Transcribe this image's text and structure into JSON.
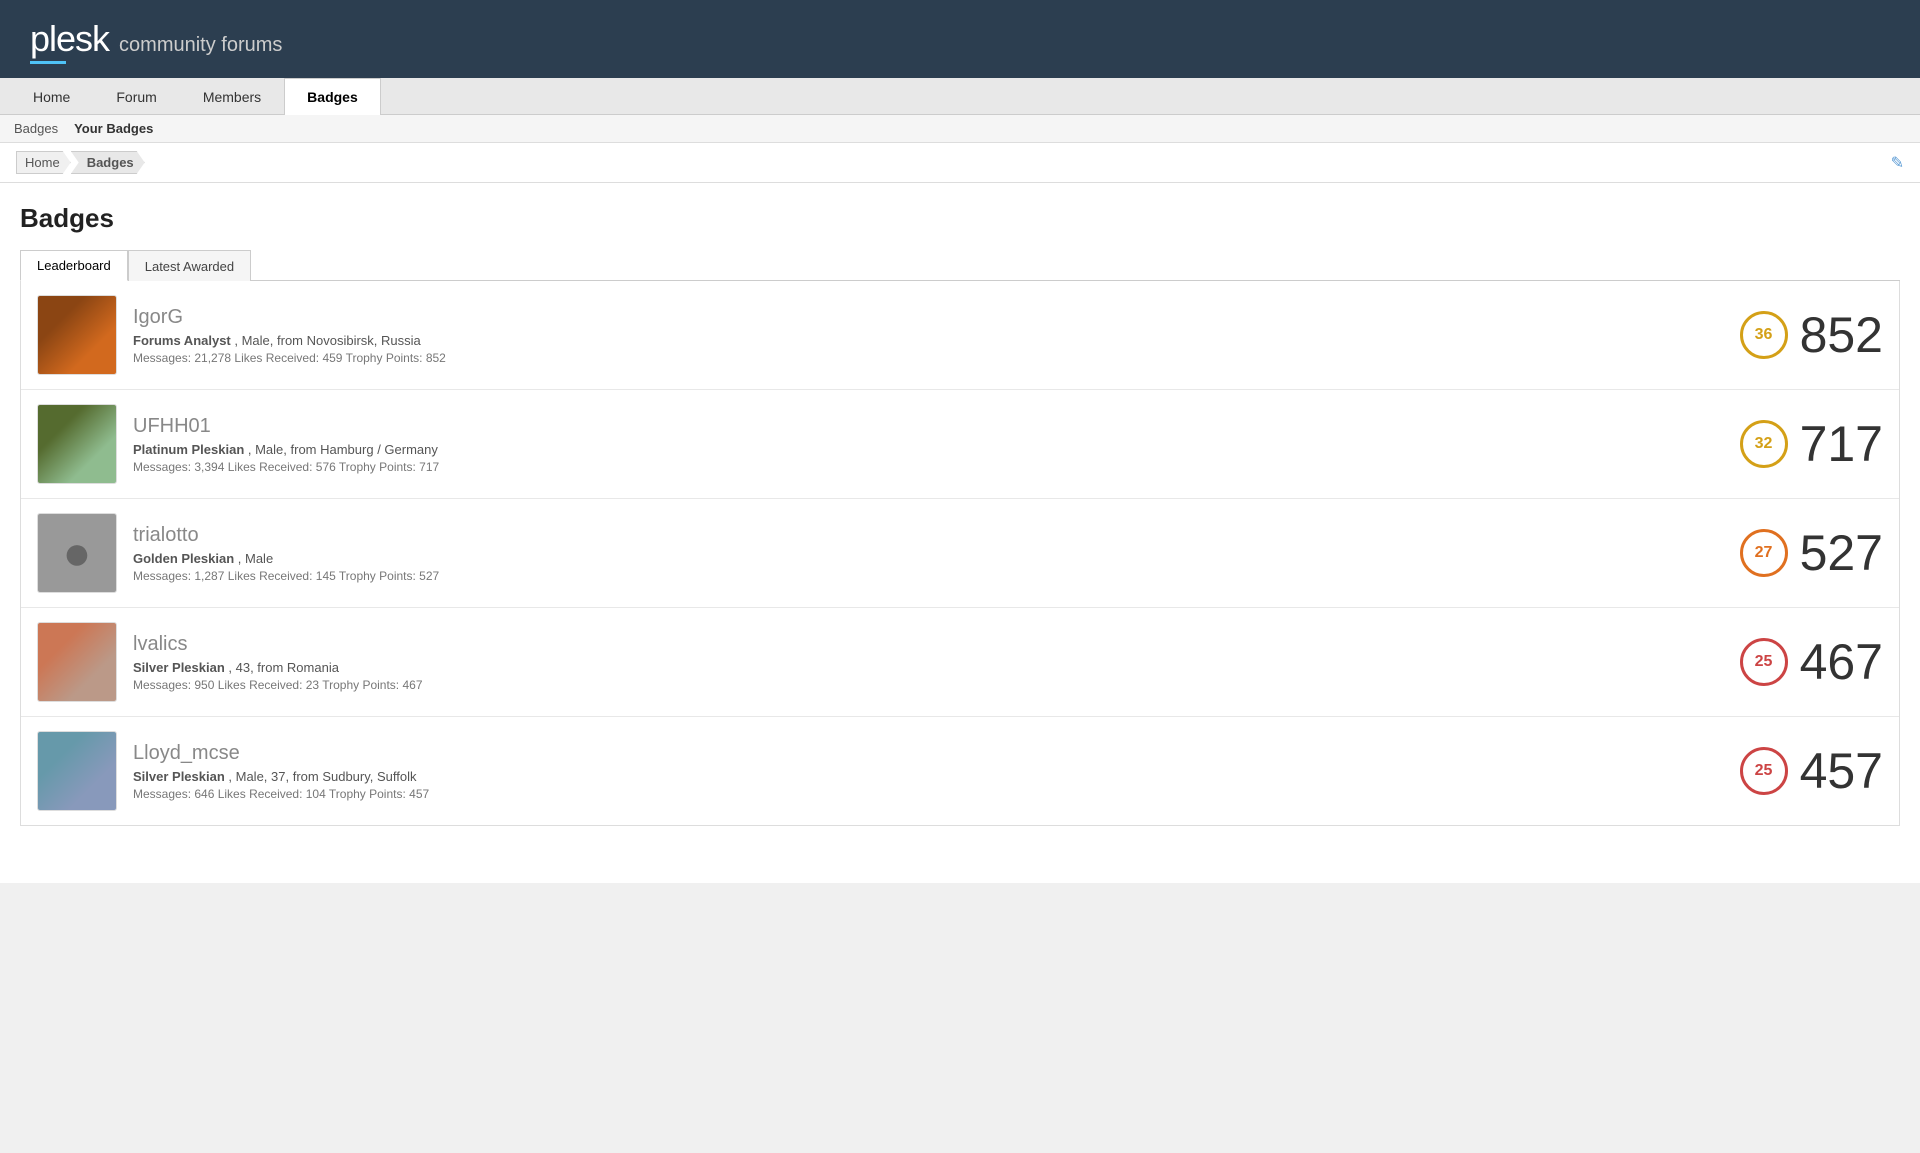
{
  "header": {
    "logo_main": "plesk",
    "logo_sub": "community forums"
  },
  "primary_nav": {
    "tabs": [
      {
        "id": "home",
        "label": "Home",
        "active": false
      },
      {
        "id": "forum",
        "label": "Forum",
        "active": false
      },
      {
        "id": "members",
        "label": "Members",
        "active": false
      },
      {
        "id": "badges",
        "label": "Badges",
        "active": true
      }
    ]
  },
  "secondary_nav": {
    "links": [
      {
        "id": "badges-link",
        "label": "Badges",
        "active": false
      },
      {
        "id": "your-badges-link",
        "label": "Your Badges",
        "active": true
      }
    ]
  },
  "breadcrumb": {
    "items": [
      {
        "id": "home",
        "label": "Home"
      },
      {
        "id": "badges",
        "label": "Badges"
      }
    ],
    "edit_icon": "✎"
  },
  "page": {
    "title": "Badges",
    "tabs": [
      {
        "id": "leaderboard",
        "label": "Leaderboard",
        "active": true
      },
      {
        "id": "latest-awarded",
        "label": "Latest Awarded",
        "active": false
      }
    ]
  },
  "leaderboard": [
    {
      "username": "IgorG",
      "title": "Forums Analyst",
      "meta": "Male, from Novosibirsk, Russia",
      "stats": "Messages: 21,278  Likes Received: 459  Trophy Points: 852",
      "badge_count": 36,
      "trophy_points": 852,
      "badge_color": "gold",
      "avatar_class": "avatar-img-1"
    },
    {
      "username": "UFHH01",
      "title": "Platinum Pleskian",
      "meta": "Male, from Hamburg / Germany",
      "stats": "Messages: 3,394  Likes Received: 576  Trophy Points: 717",
      "badge_count": 32,
      "trophy_points": 717,
      "badge_color": "gold",
      "avatar_class": "avatar-img-2"
    },
    {
      "username": "trialotto",
      "title": "Golden Pleskian",
      "meta": "Male",
      "stats": "Messages: 1,287  Likes Received: 145  Trophy Points: 527",
      "badge_count": 27,
      "trophy_points": 527,
      "badge_color": "orange",
      "avatar_class": "avatar-img-3"
    },
    {
      "username": "lvalics",
      "title": "Silver Pleskian",
      "meta": "43, from Romania",
      "stats": "Messages: 950  Likes Received: 23  Trophy Points: 467",
      "badge_count": 25,
      "trophy_points": 467,
      "badge_color": "red",
      "avatar_class": "avatar-img-4"
    },
    {
      "username": "Lloyd_mcse",
      "title": "Silver Pleskian",
      "meta": "Male, 37, from Sudbury, Suffolk",
      "stats": "Messages: 646  Likes Received: 104  Trophy Points: 457",
      "badge_count": 25,
      "trophy_points": 457,
      "badge_color": "red",
      "avatar_class": "avatar-img-5"
    }
  ]
}
